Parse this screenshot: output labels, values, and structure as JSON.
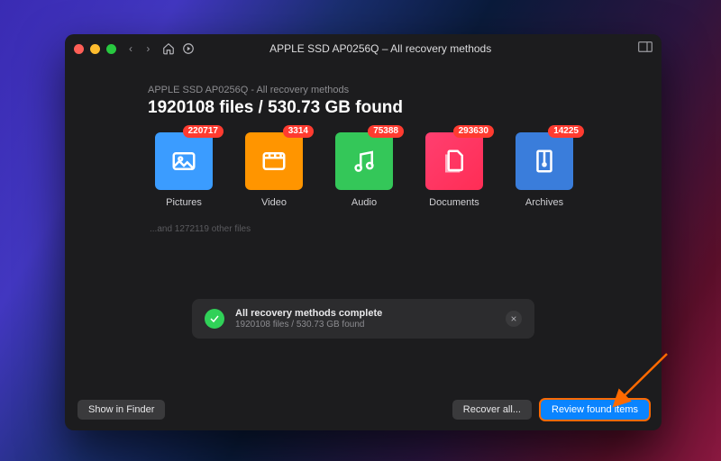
{
  "window_title": "APPLE SSD AP0256Q – All recovery methods",
  "header": {
    "subtitle": "APPLE SSD AP0256Q - All recovery methods",
    "headline": "1920108 files / 530.73 GB found"
  },
  "categories": [
    {
      "label": "Pictures",
      "badge": "220717"
    },
    {
      "label": "Video",
      "badge": "3314"
    },
    {
      "label": "Audio",
      "badge": "75388"
    },
    {
      "label": "Documents",
      "badge": "293630"
    },
    {
      "label": "Archives",
      "badge": "14225"
    }
  ],
  "other_files": "...and 1272119 other files",
  "status": {
    "primary": "All recovery methods complete",
    "secondary": "1920108 files / 530.73 GB found"
  },
  "footer": {
    "show_in_finder": "Show in Finder",
    "recover_all": "Recover all...",
    "review": "Review found items"
  }
}
